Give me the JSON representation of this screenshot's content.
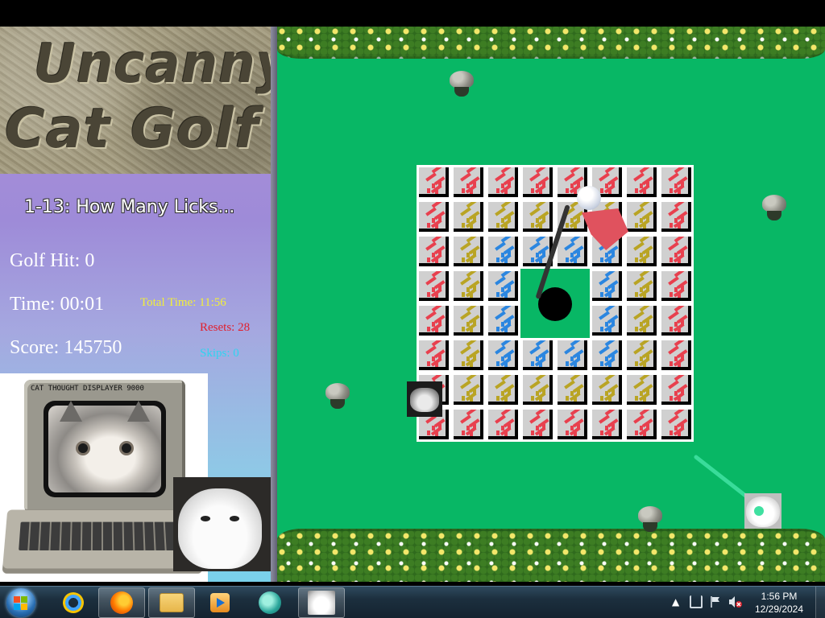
{
  "game": {
    "logo_line_1": "Uncanny",
    "logo_line_2": "Cat Golf",
    "level_title": "1-13: How Many Licks...",
    "golf_hit": "Golf Hit: 0",
    "time": "Time: 00:01",
    "score": "Score: 145750",
    "total_time": "Total Time: 11:56",
    "resets": "Resets: 28",
    "skips": "Skips: 0",
    "computer_label": "CAT THOUGHT DISPLAYER 9000"
  },
  "board": {
    "rows": 8,
    "cols": 8,
    "tile_colors": {
      "R": "#e8404e",
      "Y": "#b9a424",
      "B": "#2b86e0"
    },
    "layout": [
      "RRRRRRRR",
      "RYYYYYYR",
      "RYBBBBYR",
      "RYB..BYR",
      "RYB..BYR",
      "RYBBBBYR",
      "RYYYYYYR",
      "RRRRRRRR"
    ]
  },
  "colors": {
    "field": "#08b765",
    "panel_top": "#b08fd6",
    "panel_bottom": "#79d0ea"
  },
  "taskbar": {
    "apps": [
      {
        "name": "internet-explorer",
        "icon": "ie-icon"
      },
      {
        "name": "firefox",
        "icon": "firefox-icon"
      },
      {
        "name": "windows-explorer",
        "icon": "folder-icon"
      },
      {
        "name": "media-player",
        "icon": "media-icon"
      },
      {
        "name": "game-app",
        "icon": "game-icon"
      },
      {
        "name": "cat-golf-window",
        "icon": "cat-icon"
      }
    ],
    "clock_time": "1:56 PM",
    "clock_date": "12/29/2024"
  }
}
